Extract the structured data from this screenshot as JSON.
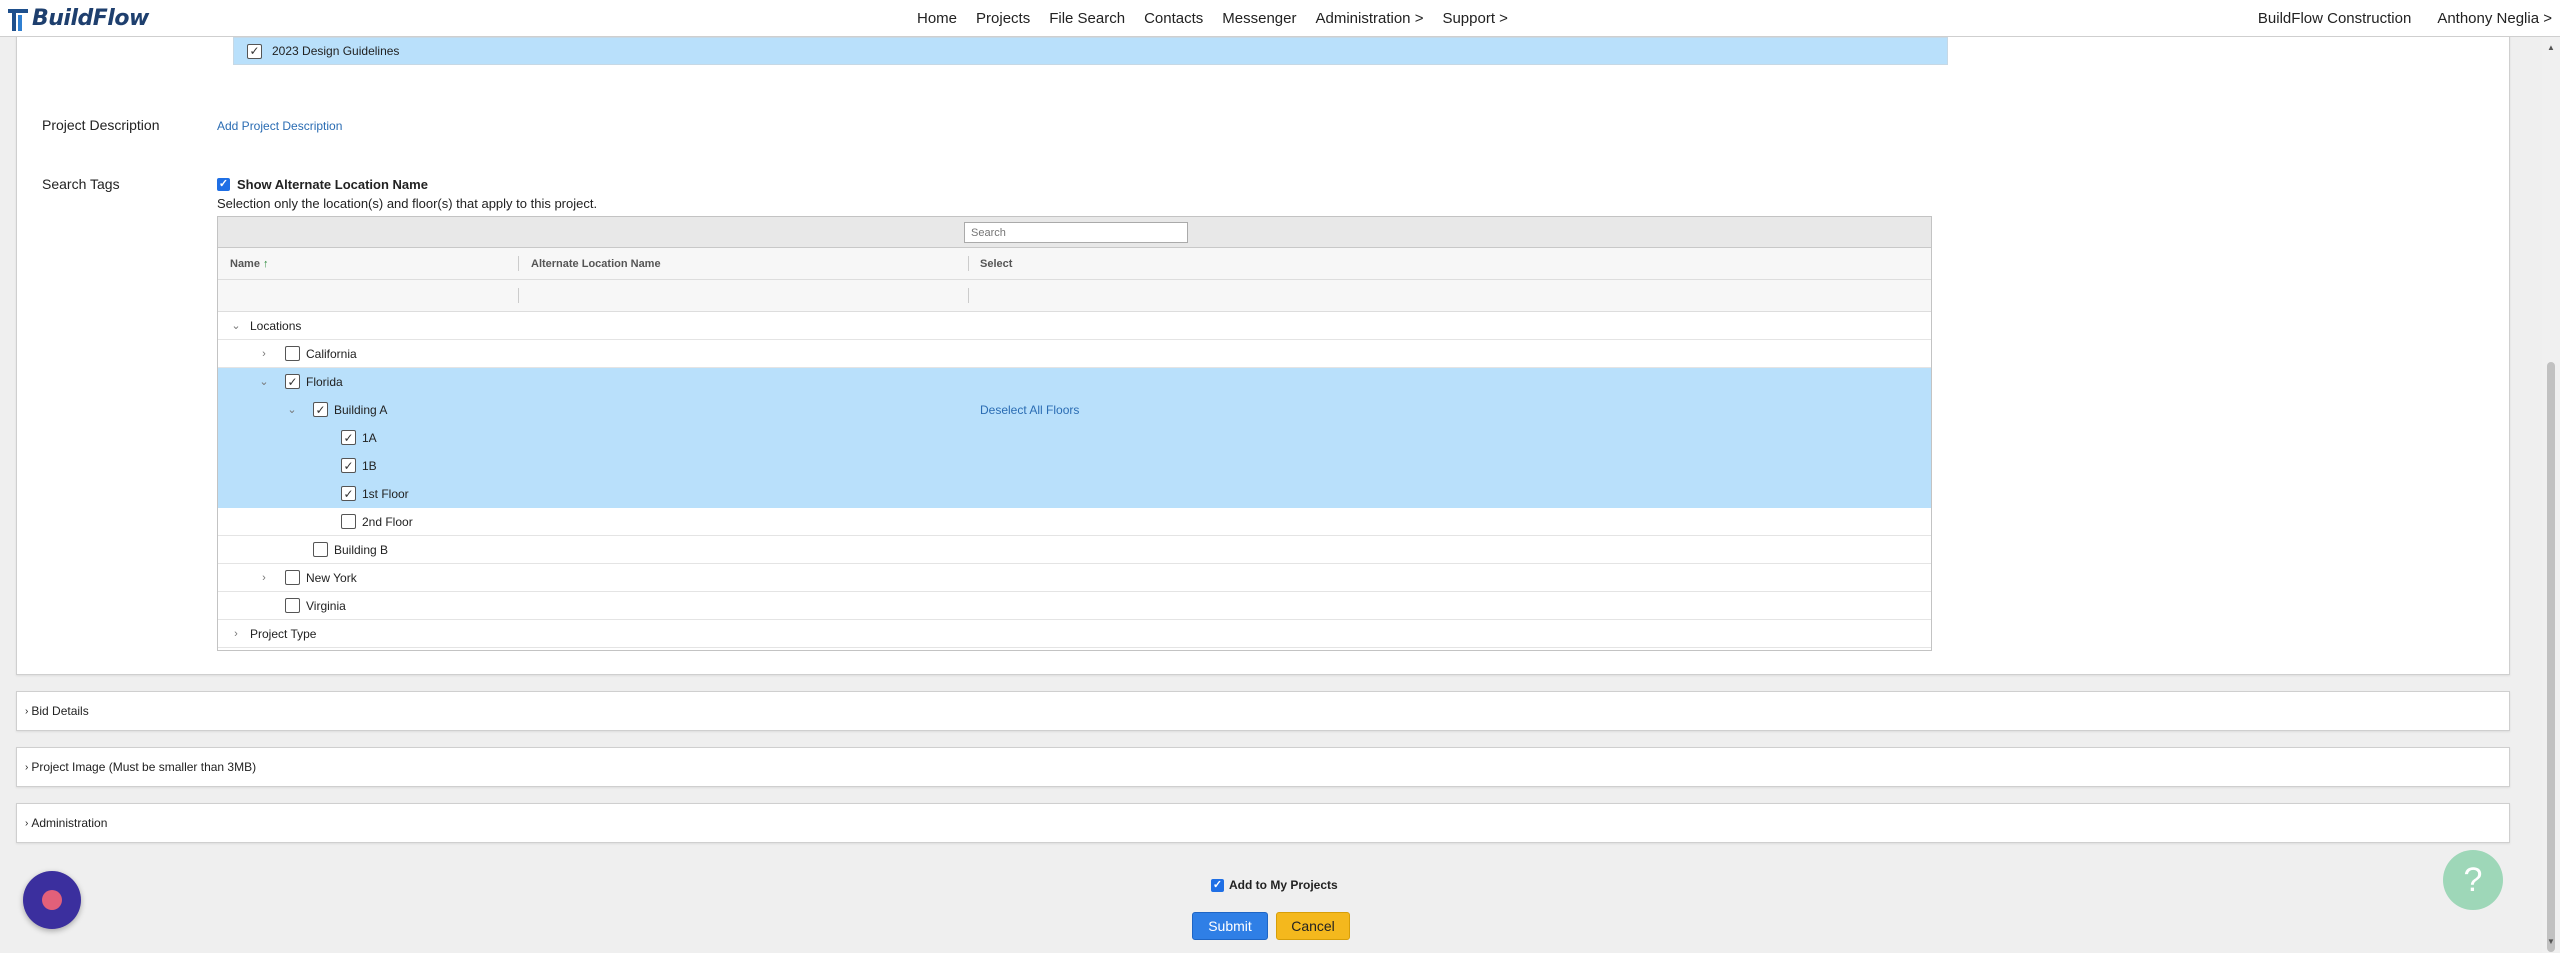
{
  "app": {
    "logo_text": "BuildFlow"
  },
  "nav": {
    "items": [
      "Home",
      "Projects",
      "File Search",
      "Contacts",
      "Messenger",
      "Administration >",
      "Support >"
    ],
    "company": "BuildFlow Construction",
    "user": "Anthony Neglia >"
  },
  "form": {
    "guideline_item": "2023 Design Guidelines",
    "project_description_label": "Project Description",
    "add_description_link": "Add Project Description",
    "search_tags_label": "Search Tags",
    "show_alternate_label": "Show Alternate Location Name",
    "selection_hint": "Selection only the location(s) and floor(s) that apply to this project."
  },
  "tree": {
    "search_placeholder": "Search",
    "columns": {
      "name": "Name",
      "alternate": "Alternate Location Name",
      "select": "Select"
    },
    "sort_icon": "↑",
    "rows": [
      {
        "label": "Locations",
        "level": 0,
        "expander": "down",
        "checkbox": false,
        "checked": false,
        "selected": false
      },
      {
        "label": "California",
        "level": 1,
        "expander": "right",
        "checkbox": true,
        "checked": false,
        "selected": false
      },
      {
        "label": "Florida",
        "level": 1,
        "expander": "down",
        "checkbox": true,
        "checked": true,
        "selected": true
      },
      {
        "label": "Building A",
        "level": 2,
        "expander": "down",
        "checkbox": true,
        "checked": true,
        "selected": true,
        "action": "Deselect All Floors"
      },
      {
        "label": "1A",
        "level": 3,
        "expander": "none",
        "checkbox": true,
        "checked": true,
        "selected": true
      },
      {
        "label": "1B",
        "level": 3,
        "expander": "none",
        "checkbox": true,
        "checked": true,
        "selected": true
      },
      {
        "label": "1st Floor",
        "level": 3,
        "expander": "none",
        "checkbox": true,
        "checked": true,
        "selected": true
      },
      {
        "label": "2nd Floor",
        "level": 3,
        "expander": "none",
        "checkbox": true,
        "checked": false,
        "selected": false
      },
      {
        "label": "Building B",
        "level": 2,
        "expander": "none",
        "checkbox": true,
        "checked": false,
        "selected": false
      },
      {
        "label": "New York",
        "level": 1,
        "expander": "right",
        "checkbox": true,
        "checked": false,
        "selected": false
      },
      {
        "label": "Virginia",
        "level": 1,
        "expander": "none",
        "checkbox": true,
        "checked": false,
        "selected": false
      },
      {
        "label": "Project Type",
        "level": 0,
        "expander": "right",
        "checkbox": false,
        "checked": false,
        "selected": false
      }
    ]
  },
  "sections": {
    "bid_details": "Bid Details",
    "project_image": "Project Image (Must be smaller than 3MB)",
    "administration": "Administration"
  },
  "footer": {
    "add_to_my_projects": "Add to My Projects",
    "submit": "Submit",
    "cancel": "Cancel"
  },
  "widgets": {
    "help_glyph": "?"
  },
  "colors": {
    "selected_row": "#b9e0fb",
    "submit": "#2f7fe6",
    "cancel": "#f4b81d",
    "link": "#2a6cb3"
  }
}
